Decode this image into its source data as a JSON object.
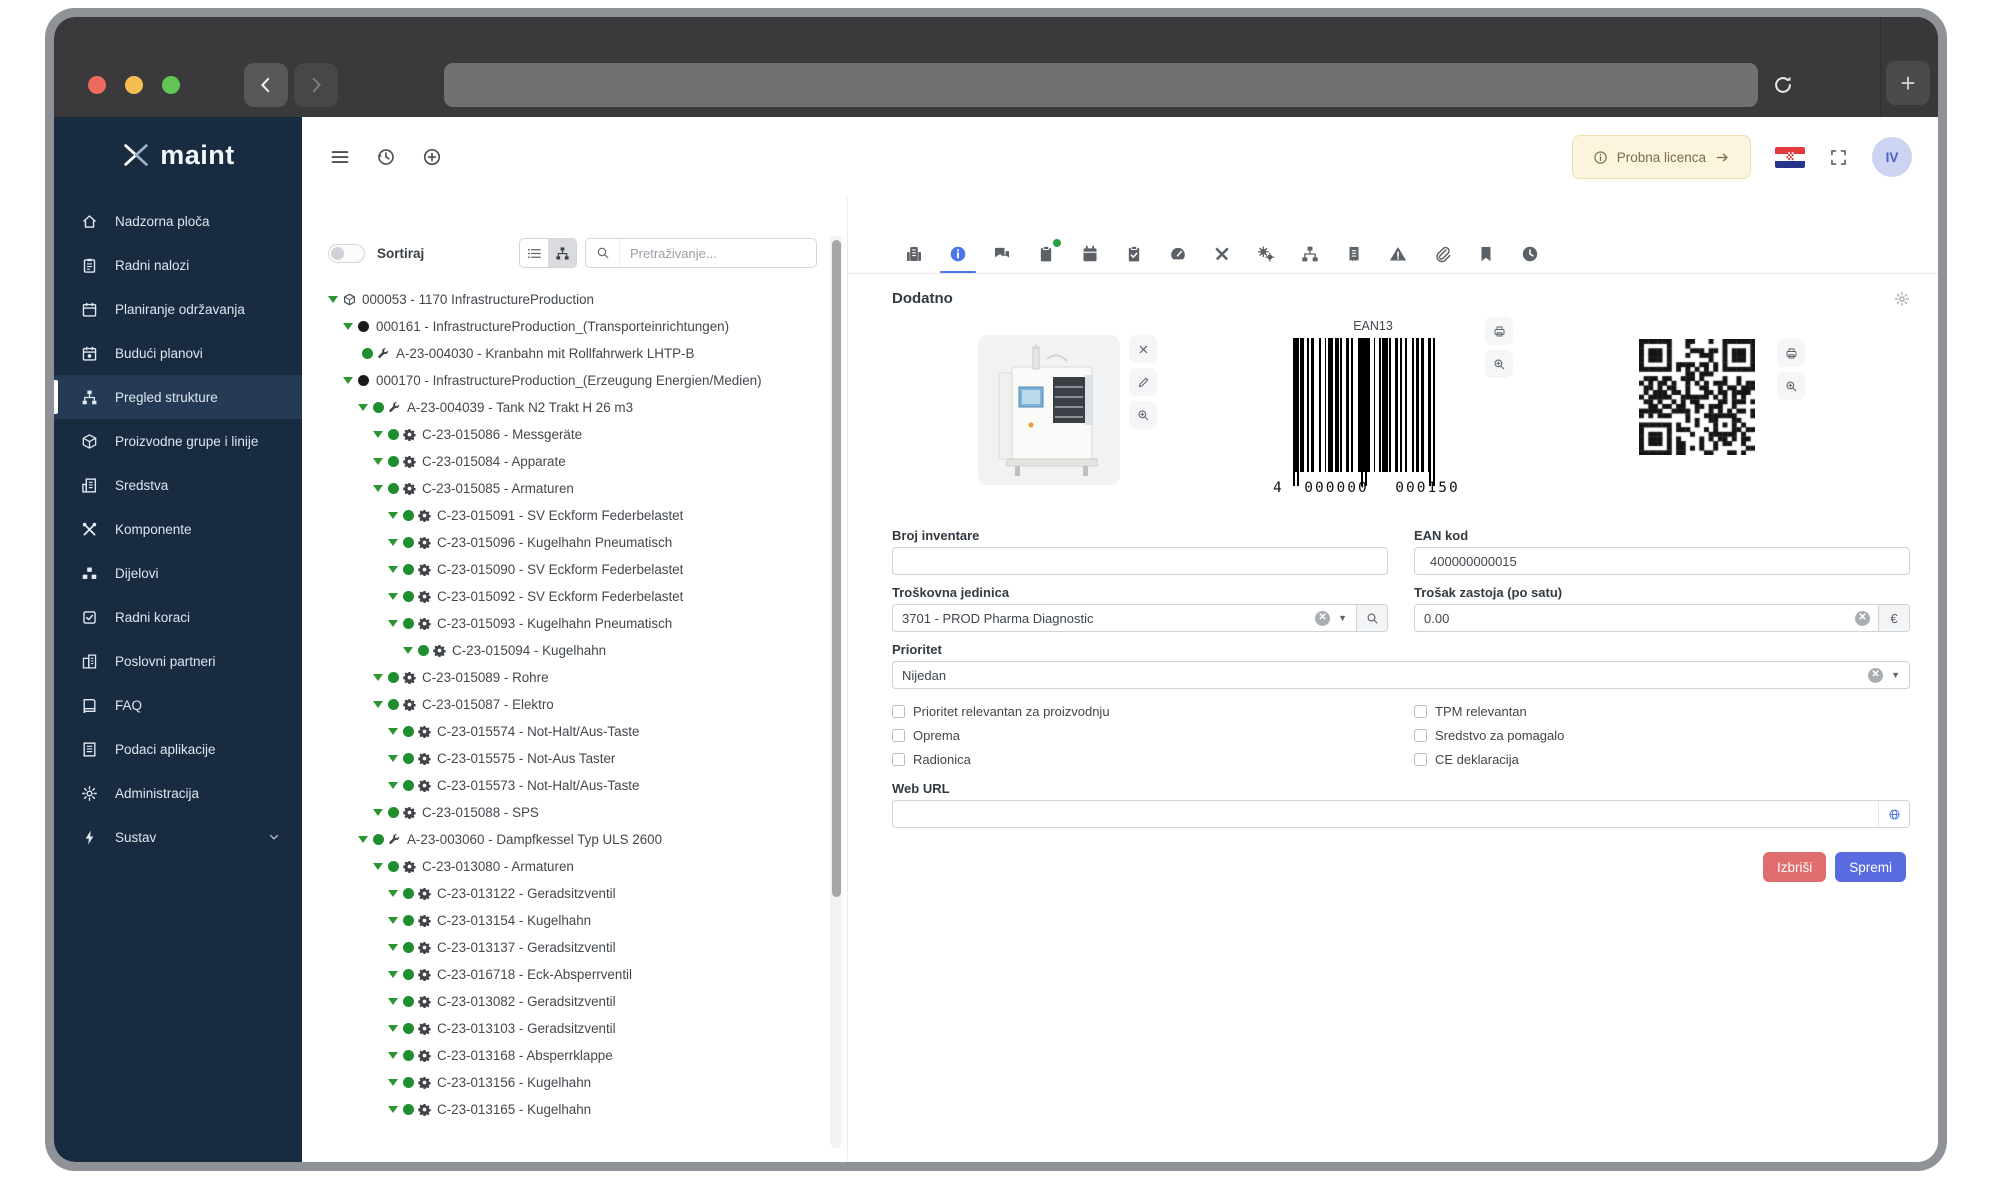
{
  "colors": {
    "accent_blue": "#4a74e8",
    "save_blue": "#5a6be0",
    "danger_red": "#df6d6d",
    "status_green": "#2c9532",
    "sidebar_navy": "#182b41",
    "license_bg": "#fcf5dd"
  },
  "browser": {
    "url": ""
  },
  "sidebar": {
    "logo_text": "maint",
    "items": [
      {
        "label": "Nadzorna ploča",
        "icon": "home-icon"
      },
      {
        "label": "Radni nalozi",
        "icon": "clipboard-icon"
      },
      {
        "label": "Planiranje održavanja",
        "icon": "calendar-icon"
      },
      {
        "label": "Budući planovi",
        "icon": "calendar-future-icon"
      },
      {
        "label": "Pregled strukture",
        "icon": "sitemap-icon",
        "active": true
      },
      {
        "label": "Proizvodne grupe i linije",
        "icon": "cube-icon"
      },
      {
        "label": "Sredstva",
        "icon": "assets-icon"
      },
      {
        "label": "Komponente",
        "icon": "tools-icon"
      },
      {
        "label": "Dijelovi",
        "icon": "parts-icon"
      },
      {
        "label": "Radni koraci",
        "icon": "tasks-icon"
      },
      {
        "label": "Poslovni partneri",
        "icon": "partners-icon"
      },
      {
        "label": "FAQ",
        "icon": "faq-icon"
      },
      {
        "label": "Podaci aplikacije",
        "icon": "app-data-icon"
      },
      {
        "label": "Administracija",
        "icon": "gear-icon"
      },
      {
        "label": "Sustav",
        "icon": "bolt-icon",
        "expandable": true
      }
    ]
  },
  "topbar": {
    "license_label": "Probna licenca",
    "avatar_initials": "IV"
  },
  "tree_panel": {
    "sort_label": "Sortiraj",
    "search_placeholder": "Pretraživanje...",
    "items": [
      {
        "depth": 0,
        "type": "site",
        "label": "000053 - 1170 InfrastructureProduction"
      },
      {
        "depth": 1,
        "type": "black",
        "label": "000161 - InfrastructureProduction_(Transporteinrichtungen)"
      },
      {
        "depth": 2,
        "type": "asset",
        "leaf": true,
        "label": "A-23-004030 - Kranbahn mit Rollfahrwerk LHTP-B"
      },
      {
        "depth": 1,
        "type": "black",
        "label": "000170 - InfrastructureProduction_(Erzeugung Energien/Medien)"
      },
      {
        "depth": 2,
        "type": "asset",
        "label": "A-23-004039 - Tank N2 Trakt H 26 m3"
      },
      {
        "depth": 3,
        "type": "component",
        "label": "C-23-015086 - Messgeräte"
      },
      {
        "depth": 3,
        "type": "component",
        "label": "C-23-015084 - Apparate"
      },
      {
        "depth": 3,
        "type": "component",
        "label": "C-23-015085 - Armaturen"
      },
      {
        "depth": 4,
        "type": "component",
        "label": "C-23-015091 - SV Eckform Federbelastet"
      },
      {
        "depth": 4,
        "type": "component",
        "label": "C-23-015096 - Kugelhahn Pneumatisch"
      },
      {
        "depth": 4,
        "type": "component",
        "label": "C-23-015090 - SV Eckform Federbelastet"
      },
      {
        "depth": 4,
        "type": "component",
        "label": "C-23-015092 - SV Eckform Federbelastet"
      },
      {
        "depth": 4,
        "type": "component",
        "label": "C-23-015093 - Kugelhahn Pneumatisch"
      },
      {
        "depth": 5,
        "type": "component",
        "label": "C-23-015094 - Kugelhahn"
      },
      {
        "depth": 3,
        "type": "component",
        "label": "C-23-015089 - Rohre"
      },
      {
        "depth": 3,
        "type": "component",
        "label": "C-23-015087 - Elektro"
      },
      {
        "depth": 4,
        "type": "component",
        "label": "C-23-015574 - Not-Halt/Aus-Taste"
      },
      {
        "depth": 4,
        "type": "component",
        "label": "C-23-015575 - Not-Aus Taster"
      },
      {
        "depth": 4,
        "type": "component",
        "label": "C-23-015573 - Not-Halt/Aus-Taste"
      },
      {
        "depth": 3,
        "type": "component",
        "label": "C-23-015088 - SPS"
      },
      {
        "depth": 2,
        "type": "asset",
        "label": "A-23-003060 - Dampfkessel Typ ULS 2600"
      },
      {
        "depth": 3,
        "type": "component",
        "label": "C-23-013080 - Armaturen"
      },
      {
        "depth": 4,
        "type": "component",
        "label": "C-23-013122 - Geradsitzventil"
      },
      {
        "depth": 4,
        "type": "component",
        "label": "C-23-013154 - Kugelhahn"
      },
      {
        "depth": 4,
        "type": "component",
        "label": "C-23-013137 - Geradsitzventil"
      },
      {
        "depth": 4,
        "type": "component",
        "label": "C-23-016718 - Eck-Absperrventil"
      },
      {
        "depth": 4,
        "type": "component",
        "label": "C-23-013082 - Geradsitzventil"
      },
      {
        "depth": 4,
        "type": "component",
        "label": "C-23-013103 - Geradsitzventil"
      },
      {
        "depth": 4,
        "type": "component",
        "label": "C-23-013168 - Absperrklappe"
      },
      {
        "depth": 4,
        "type": "component",
        "label": "C-23-013156 - Kugelhahn"
      },
      {
        "depth": 4,
        "type": "component",
        "label": "C-23-013165 - Kugelhahn"
      }
    ]
  },
  "detail": {
    "heading": "Dodatno",
    "tabs": [
      {
        "icon": "fax-icon"
      },
      {
        "icon": "info-icon",
        "active": true
      },
      {
        "icon": "chat-icon"
      },
      {
        "icon": "clipboard2-icon",
        "badge": true
      },
      {
        "icon": "calendar2-icon"
      },
      {
        "icon": "clipboard-check-icon"
      },
      {
        "icon": "gauge-icon"
      },
      {
        "icon": "tools2-icon"
      },
      {
        "icon": "gears-icon"
      },
      {
        "icon": "sitemap2-icon"
      },
      {
        "icon": "receipt-icon"
      },
      {
        "icon": "warning-icon"
      },
      {
        "icon": "paperclip-icon"
      },
      {
        "icon": "bookmark-icon"
      },
      {
        "icon": "clock-icon"
      }
    ],
    "barcode": {
      "format_label": "EAN13",
      "digits_first": "4",
      "digits_group1": "000000",
      "digits_group2": "000150"
    },
    "fields": {
      "broj_inventare": {
        "label": "Broj inventare",
        "value": ""
      },
      "ean_kod": {
        "label": "EAN kod",
        "value": "400000000015"
      },
      "troskovna_jedinica": {
        "label": "Troškovna jedinica",
        "value": "3701 - PROD Pharma Diagnostic"
      },
      "trosak_zastoja": {
        "label": "Trošak zastoja (po satu)",
        "value": "0.00",
        "currency": "€"
      },
      "prioritet": {
        "label": "Prioritet",
        "value": "Nijedan"
      },
      "web_url": {
        "label": "Web URL",
        "value": ""
      }
    },
    "checkboxes": [
      {
        "label": "Prioritet relevantan za proizvodnju",
        "checked": false
      },
      {
        "label": "TPM relevantan",
        "checked": false
      },
      {
        "label": "Oprema",
        "checked": false
      },
      {
        "label": "Sredstvo za pomagalo",
        "checked": false
      },
      {
        "label": "Radionica",
        "checked": false
      },
      {
        "label": "CE deklaracija",
        "checked": false
      }
    ],
    "buttons": {
      "delete": "Izbriši",
      "save": "Spremi"
    }
  }
}
